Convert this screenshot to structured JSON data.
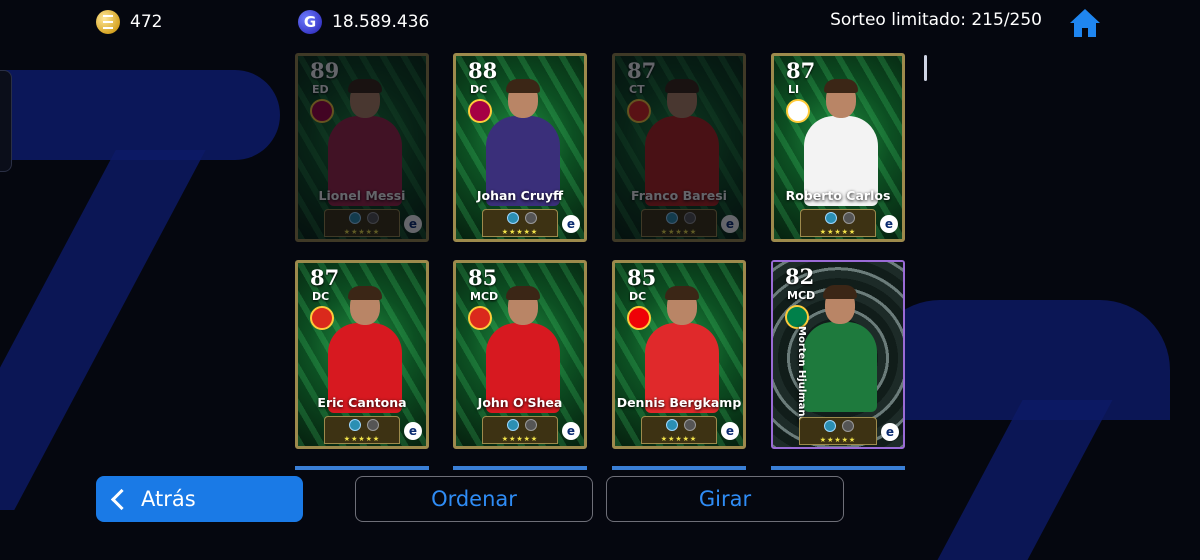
{
  "topbar": {
    "coins": "472",
    "gp": "18.589.436",
    "draw_status": "Sorteo limitado: 215/250"
  },
  "cards": [
    {
      "rating": "89",
      "position": "ED",
      "name": "Lionel Messi",
      "state": "dim",
      "kit": "#a3254a",
      "club_color": "#a50044"
    },
    {
      "rating": "88",
      "position": "DC",
      "name": "Johan Cruyff",
      "state": "normal",
      "kit": "#3a2f7a",
      "club_color": "#a50044"
    },
    {
      "rating": "87",
      "position": "CT",
      "name": "Franco Baresi",
      "state": "dim",
      "kit": "#b8231f",
      "club_color": "#e32221"
    },
    {
      "rating": "87",
      "position": "LI",
      "name": "Roberto Carlos",
      "state": "normal",
      "kit": "#f3f3f3",
      "club_color": "#ffffff"
    },
    {
      "rating": "87",
      "position": "DC",
      "name": "Eric Cantona",
      "state": "normal",
      "kit": "#d71920",
      "club_color": "#da291c"
    },
    {
      "rating": "85",
      "position": "MCD",
      "name": "John O'Shea",
      "state": "normal",
      "kit": "#d71920",
      "club_color": "#da291c"
    },
    {
      "rating": "85",
      "position": "DC",
      "name": "Dennis Bergkamp",
      "state": "normal",
      "kit": "#e0292b",
      "club_color": "#ef0107"
    },
    {
      "rating": "82",
      "position": "MCD",
      "name": "Morten Hjulmand",
      "state": "selected",
      "kit": "#1e7a3d",
      "club_color": "#00804a"
    }
  ],
  "stars": "★★★★★",
  "e_logo": "e",
  "buttons": {
    "back": "Atrás",
    "sort": "Ordenar",
    "spin": "Girar"
  },
  "colors": {
    "accent_blue": "#1a7ae6",
    "card_gold_border": "#9d8a4c",
    "selected_border": "#9a6bd6"
  },
  "icons": [
    "efootball-coin-icon",
    "gp-icon",
    "home-icon",
    "chevron-left-icon",
    "club-crest-icon"
  ]
}
